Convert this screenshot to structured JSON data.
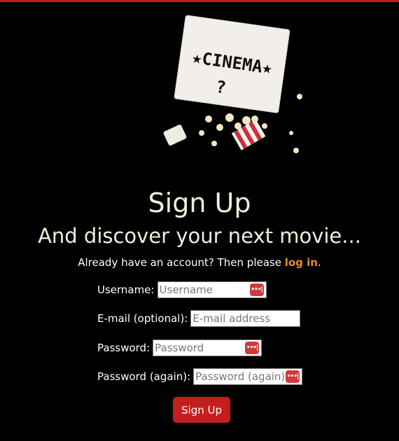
{
  "heading": "Sign Up",
  "subheading": "And discover your next movie...",
  "account_prompt": "Already have an account? Then please ",
  "login_link": "log in",
  "login_after": ".",
  "hero": {
    "lightbox_line1": "★CINEMA★",
    "lightbox_line2": "?"
  },
  "form": {
    "username": {
      "label": "Username:",
      "placeholder": "Username",
      "value": ""
    },
    "email": {
      "label": "E-mail (optional):",
      "placeholder": "E-mail address",
      "value": ""
    },
    "password": {
      "label": "Password:",
      "placeholder": "Password",
      "value": ""
    },
    "password2": {
      "label": "Password (again):",
      "placeholder": "Password (again)",
      "value": ""
    },
    "submit_label": "Sign Up"
  },
  "colors": {
    "accent": "#c31f1f",
    "link": "#f08a1e",
    "text": "#f3ecdc",
    "background": "#000000"
  },
  "icons": {
    "password_manager": "password-key-icon"
  }
}
